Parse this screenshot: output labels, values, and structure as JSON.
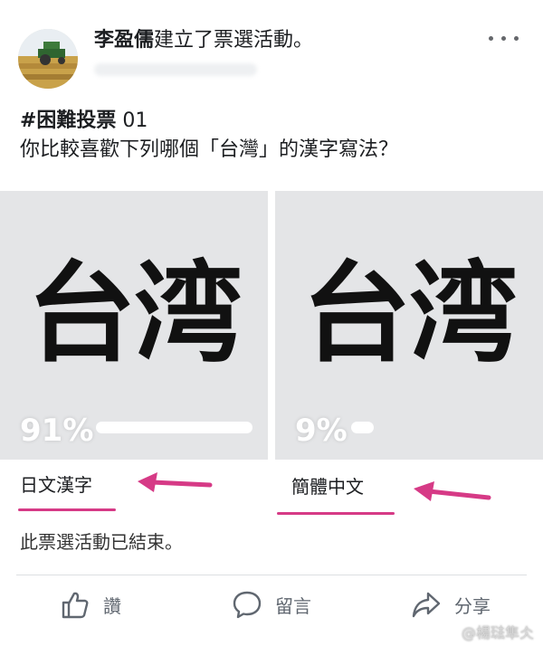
{
  "post": {
    "author": "李盈儒",
    "action_text": "建立了票選活動。",
    "hashtag": "#困難投票",
    "poll_number": " 01",
    "question": "你比較喜歡下列哪個「台灣」的漢字寫法？"
  },
  "poll": {
    "options": [
      {
        "glyph_text": "台湾",
        "percent_label": "91%",
        "percent": 0.91,
        "label": "日文漢字"
      },
      {
        "glyph_text": "台湾",
        "percent_label": "9%",
        "percent": 0.09,
        "label": "簡體中文"
      }
    ],
    "status_text": "此票選活動已結束。"
  },
  "actions": {
    "like_label": "讚",
    "comment_label": "留言",
    "share_label": "分享"
  },
  "watermark": "@楊琺隼仌",
  "colors": {
    "annotation": "#d63a86",
    "option_bg": "#e4e5e7",
    "action_text": "#606770"
  }
}
